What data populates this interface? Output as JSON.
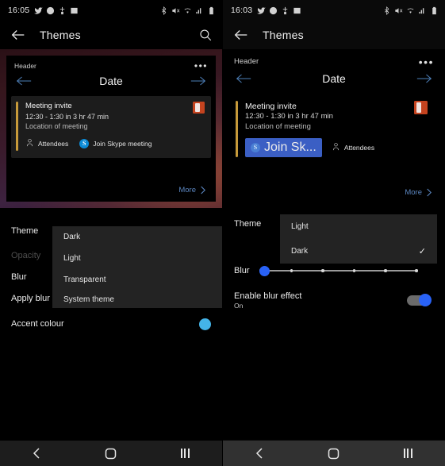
{
  "left": {
    "statusbar": {
      "time": "16:05",
      "left_icons": [
        "twitter-icon",
        "clock-icon",
        "accessibility-icon",
        "photo-icon"
      ],
      "right_icons": [
        "bluetooth-icon",
        "volume-mute-icon",
        "wifi-icon",
        "signal-icon",
        "battery-icon"
      ]
    },
    "appbar": {
      "back": "back-arrow",
      "title": "Themes",
      "search": "search-icon"
    },
    "preview": {
      "header_label": "Header",
      "overflow": "•••",
      "date_label": "Date",
      "invite": {
        "title": "Meeting invite",
        "time": "12:30 - 1:30  in 3 hr 47 min",
        "location": "Location of meeting",
        "attendees_label": "Attendees",
        "skype_label": "Join Skype meeting",
        "skype_glyph": "S"
      },
      "more_label": "More"
    },
    "settings": {
      "theme_label": "Theme",
      "opacity_label": "Opacity",
      "blur_label": "Blur",
      "apply_blur_label": "Apply blur ef",
      "accent_label": "Accent colour",
      "accent_colour": "#44b4e8"
    },
    "dropdown": {
      "options": [
        "Dark",
        "Light",
        "Transparent",
        "System theme"
      ]
    },
    "navbar": {
      "back": "back-icon",
      "home": "home-icon",
      "recents": "recents-icon"
    }
  },
  "right": {
    "statusbar": {
      "time": "16:03",
      "left_icons": [
        "twitter-icon",
        "clock-icon",
        "accessibility-icon",
        "photo-icon"
      ],
      "right_icons": [
        "bluetooth-icon",
        "volume-mute-icon",
        "wifi-icon",
        "signal-icon",
        "battery-icon"
      ]
    },
    "appbar": {
      "back": "back-arrow",
      "title": "Themes"
    },
    "preview": {
      "header_label": "Header",
      "overflow": "•••",
      "date_label": "Date",
      "invite": {
        "title": "Meeting invite",
        "time": "12:30 - 1:30  in 3 hr 47 min",
        "location": "Location of meeting",
        "skype_label": "Join Sk...",
        "skype_glyph": "S",
        "attendees_label": "Attendees"
      },
      "more_label": "More"
    },
    "settings": {
      "theme_label": "Theme",
      "blur_label": "Blur",
      "enable_blur_label": "Enable blur effect",
      "enable_blur_state": "On",
      "blur_value": 0,
      "blur_ticks": 6,
      "toggle_on": true,
      "accent_colour": "#2962f6"
    },
    "dropdown": {
      "options": [
        "Light",
        "Dark"
      ],
      "selected": "Dark",
      "check_glyph": "✓"
    },
    "navbar": {
      "back": "back-icon",
      "home": "home-icon",
      "recents": "recents-icon"
    }
  }
}
